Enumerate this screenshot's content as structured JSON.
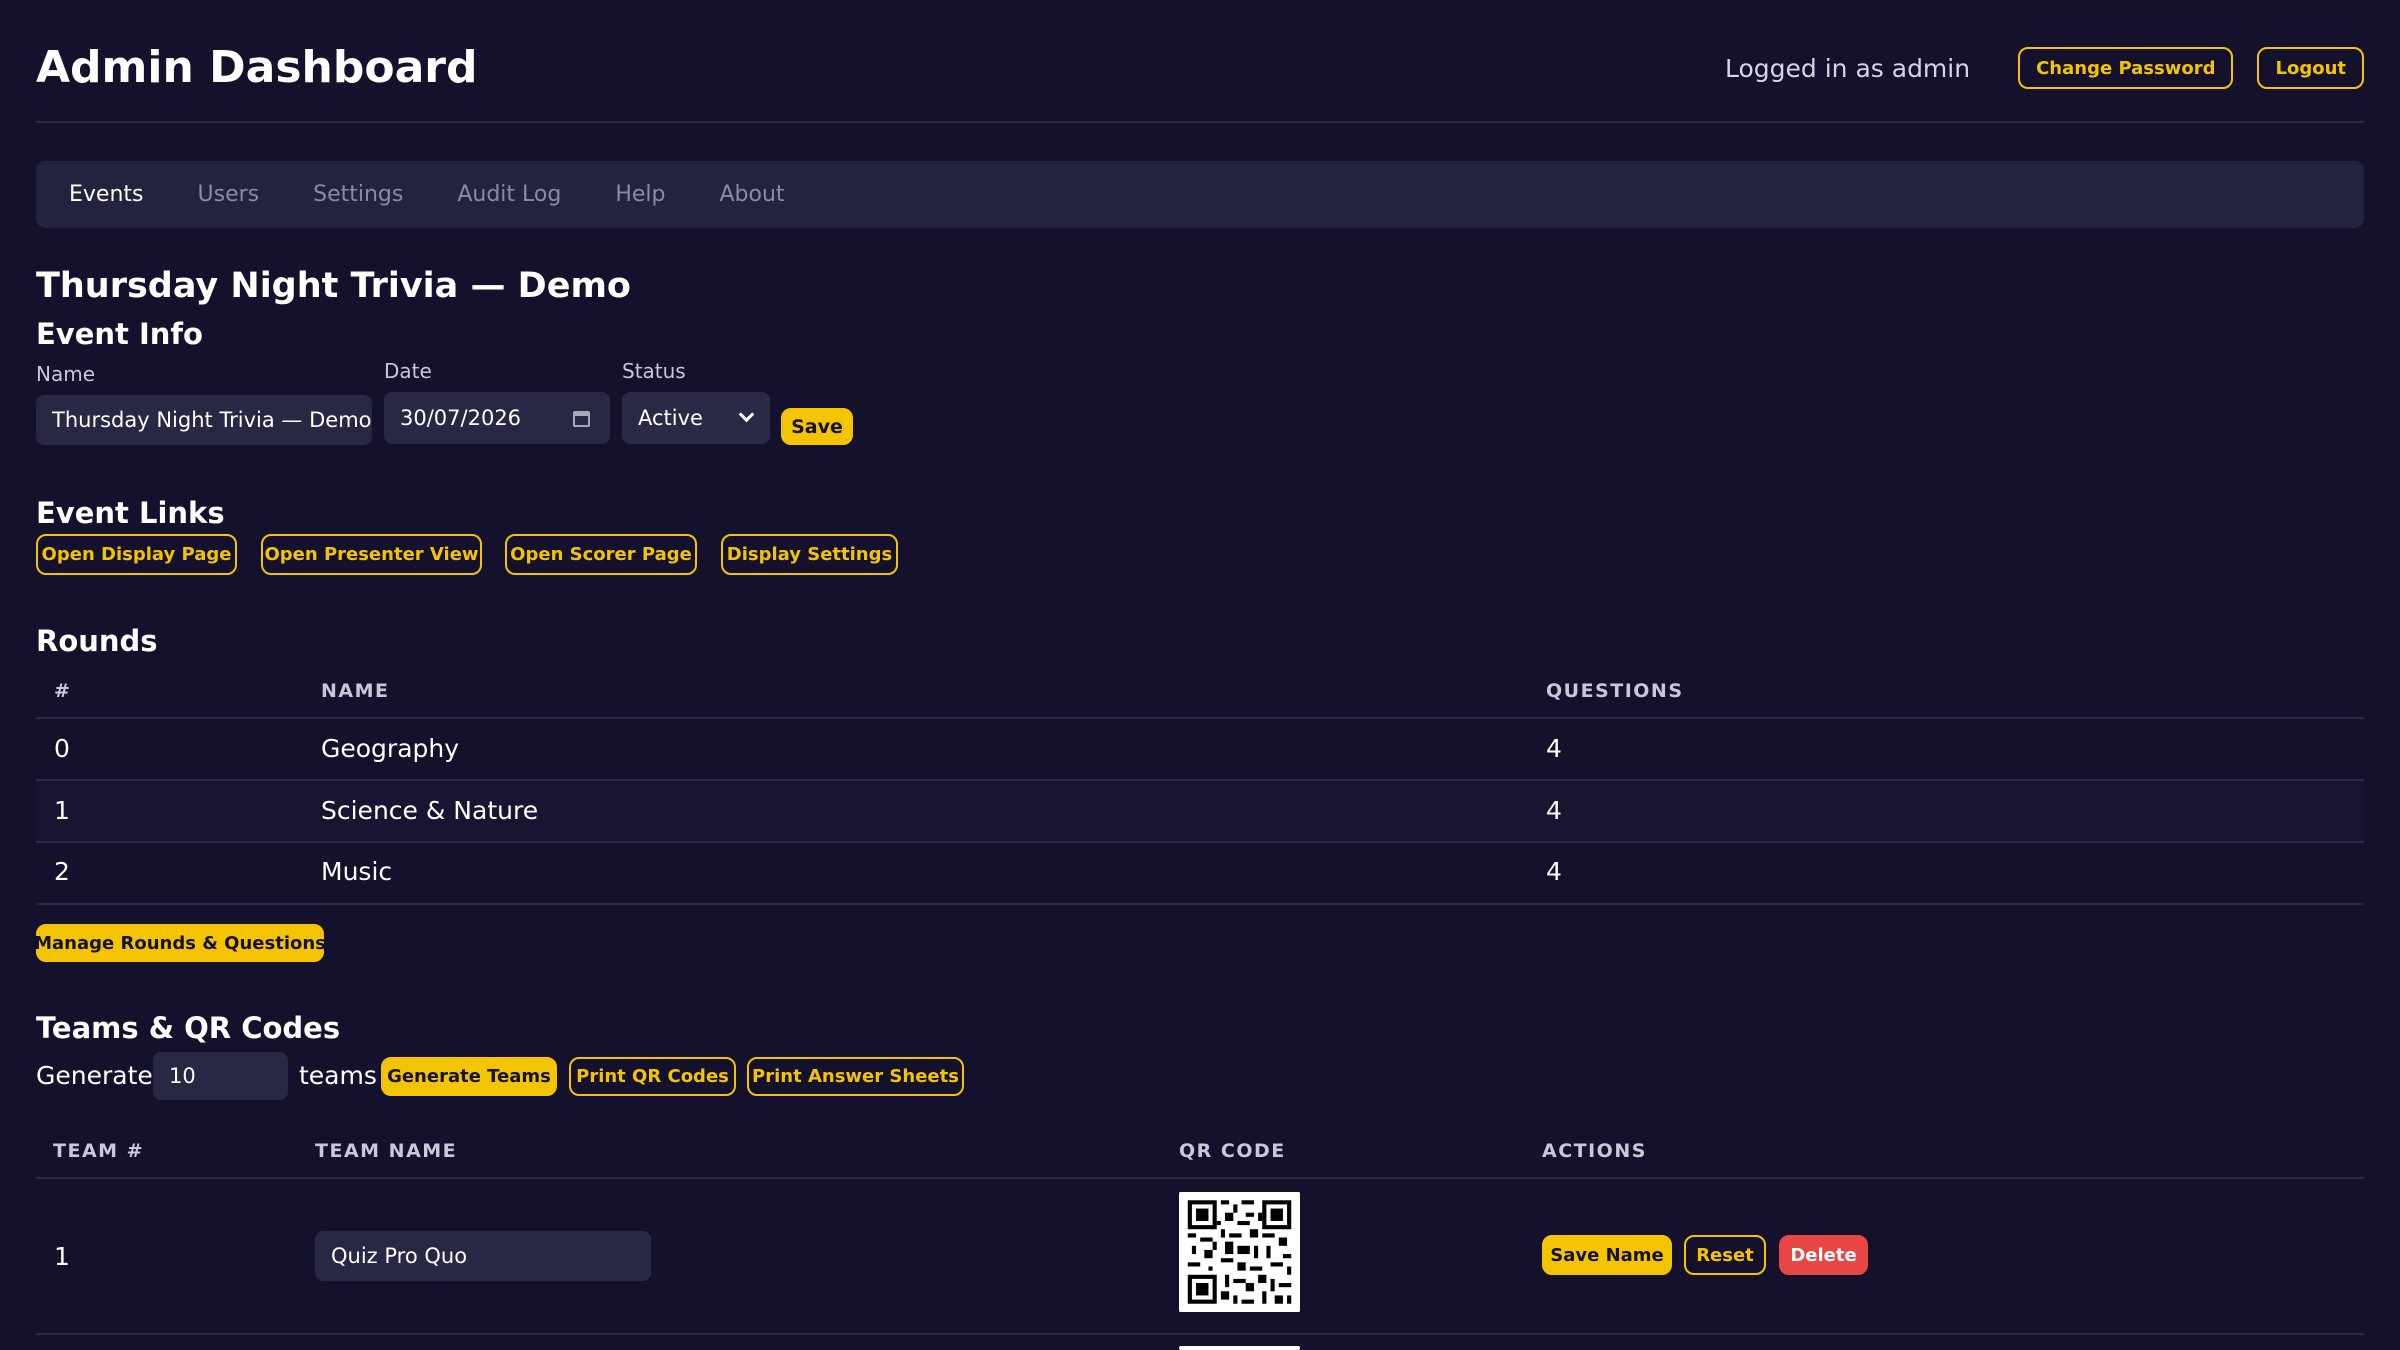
{
  "header": {
    "title": "Admin Dashboard",
    "logged_in_text": "Logged in as admin",
    "change_password": "Change Password",
    "logout": "Logout"
  },
  "nav": {
    "items": [
      "Events",
      "Users",
      "Settings",
      "Audit Log",
      "Help",
      "About"
    ],
    "active": "Events"
  },
  "event": {
    "title": "Thursday Night Trivia — Demo",
    "info_heading": "Event Info",
    "name_label": "Name",
    "name_value": "Thursday Night Trivia — Demo",
    "date_label": "Date",
    "date_value": "30/07/2026",
    "status_label": "Status",
    "status_value": "Active",
    "save_label": "Save"
  },
  "links": {
    "heading": "Event Links",
    "buttons": [
      "Open Display Page",
      "Open Presenter View",
      "Open Scorer Page",
      "Display Settings"
    ]
  },
  "rounds": {
    "heading": "Rounds",
    "columns": [
      "#",
      "NAME",
      "QUESTIONS"
    ],
    "rows": [
      {
        "num": "0",
        "name": "Geography",
        "questions": "4"
      },
      {
        "num": "1",
        "name": "Science & Nature",
        "questions": "4"
      },
      {
        "num": "2",
        "name": "Music",
        "questions": "4"
      }
    ],
    "manage_label": "Manage Rounds & Questions"
  },
  "teams": {
    "heading": "Teams & QR Codes",
    "generate_label": "Generate",
    "count_value": "10",
    "teams_label": "teams",
    "generate_button": "Generate Teams",
    "print_qr": "Print QR Codes",
    "print_sheets": "Print Answer Sheets",
    "columns": [
      "TEAM #",
      "TEAM NAME",
      "QR CODE",
      "ACTIONS"
    ],
    "rows": [
      {
        "num": "1",
        "name": "Quiz Pro Quo"
      }
    ],
    "actions": {
      "save_name": "Save Name",
      "reset": "Reset",
      "delete": "Delete"
    }
  },
  "colors": {
    "background": "#13112c",
    "accent": "#f5c400",
    "danger": "#e84545",
    "panel": "#23223f"
  }
}
